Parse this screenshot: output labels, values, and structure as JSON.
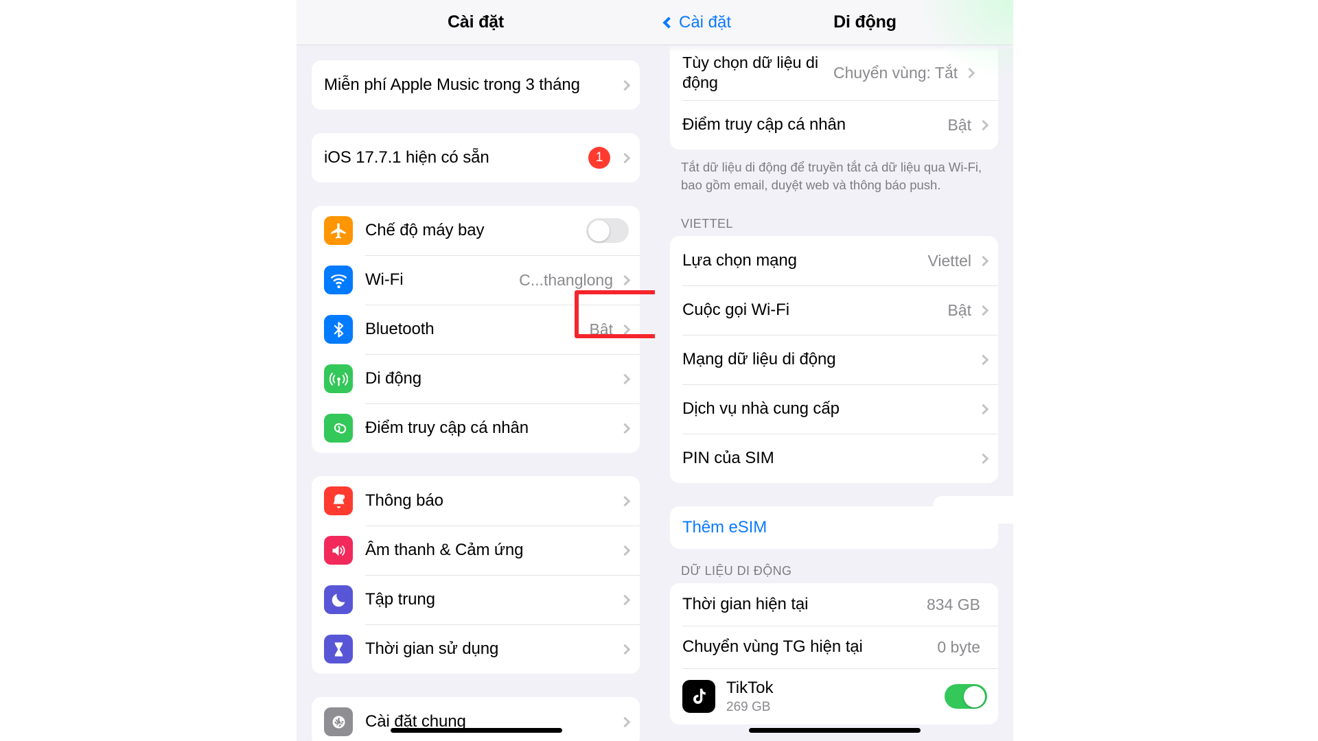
{
  "left_panel": {
    "nav": {
      "title": "Cài đặt"
    },
    "groups": [
      {
        "rows": [
          {
            "label": "Miễn phí Apple Music trong 3 tháng",
            "value": "",
            "chevron": true
          }
        ]
      },
      {
        "rows": [
          {
            "label": "iOS 17.7.1 hiện có sẵn",
            "badge": "1",
            "chevron": true
          }
        ]
      },
      {
        "rows": [
          {
            "label": "Chế độ máy bay",
            "icon": "airplane-icon",
            "icon_color": "#ff9500",
            "toggle": "off"
          },
          {
            "label": "Wi-Fi",
            "icon": "wifi-icon",
            "icon_color": "#007aff",
            "value": "C...thanglong",
            "chevron": true
          },
          {
            "label": "Bluetooth",
            "icon": "bluetooth-icon",
            "icon_color": "#007aff",
            "value": "Bật",
            "chevron": true
          },
          {
            "label": "Di động",
            "icon": "cellular-icon",
            "icon_color": "#34c759",
            "chevron": true,
            "highlighted": true
          },
          {
            "label": "Điểm truy cập cá nhân",
            "icon": "hotspot-icon",
            "icon_color": "#34c759",
            "chevron": true
          }
        ]
      },
      {
        "rows": [
          {
            "label": "Thông báo",
            "icon": "bell-icon",
            "icon_color": "#ff3b30",
            "chevron": true
          },
          {
            "label": "Âm thanh & Cảm ứng",
            "icon": "speaker-icon",
            "icon_color": "#f2295b",
            "chevron": true
          },
          {
            "label": "Tập trung",
            "icon": "moon-icon",
            "icon_color": "#5856d6",
            "chevron": true
          },
          {
            "label": "Thời gian sử dụng",
            "icon": "hourglass-icon",
            "icon_color": "#5856d6",
            "chevron": true
          }
        ]
      },
      {
        "rows": [
          {
            "label": "Cài đặt chung",
            "icon": "gear-icon",
            "icon_color": "#8e8e93",
            "chevron": true
          }
        ]
      }
    ]
  },
  "right_panel": {
    "nav": {
      "back_label": "Cài đặt",
      "title": "Di động"
    },
    "group_top": {
      "rows": [
        {
          "label": "Tùy chọn dữ liệu di động",
          "value": "Chuyển vùng: Tắt",
          "chevron": true,
          "twoline": true
        },
        {
          "label": "Điểm truy cập cá nhân",
          "value": "Bật",
          "chevron": true
        }
      ],
      "footnote": "Tắt dữ liệu di động để truyền tắt cả dữ liệu qua Wi-Fi, bao gồm email, duyệt web và thông báo push."
    },
    "carrier_section": {
      "header": "VIETTEL",
      "rows": [
        {
          "label": "Lựa chọn mạng",
          "value": "Viettel",
          "chevron": true
        },
        {
          "label": "Cuộc gọi Wi-Fi",
          "value": "Bật",
          "chevron": true
        },
        {
          "label": "Mạng dữ liệu di động",
          "value": "",
          "chevron": true
        },
        {
          "label": "Dịch vụ nhà cung cấp",
          "value": "",
          "chevron": true
        },
        {
          "label": "PIN của SIM",
          "value": "",
          "chevron": true
        }
      ]
    },
    "esim": {
      "label": "Thêm eSIM",
      "highlighted": true
    },
    "data_section": {
      "header": "DỮ LIỆU DI ĐỘNG",
      "rows": [
        {
          "label": "Thời gian hiện tại",
          "value": "834 GB"
        },
        {
          "label": "Chuyển vùng TG hiện tại",
          "value": "0 byte"
        }
      ],
      "apps": [
        {
          "name": "TikTok",
          "size": "269 GB",
          "icon": "tiktok-icon",
          "toggle": "on"
        }
      ]
    }
  },
  "colors": {
    "accent_blue": "#0a7aff",
    "highlight_red": "#f5252c",
    "toggle_green": "#34c759",
    "badge_red": "#ff3b30"
  }
}
